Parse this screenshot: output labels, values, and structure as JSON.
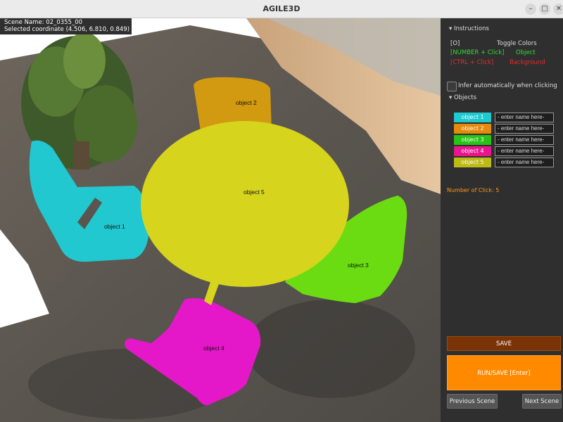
{
  "window": {
    "title": "AGILE3D",
    "minimize": "–",
    "maximize": "□",
    "close": "✕"
  },
  "overlay": {
    "scene_name": "Scene Name: 02_0355_00",
    "selected_coordinate": "Selected coordinate (4.506, 6.810, 0.849)"
  },
  "scene_objects": [
    {
      "label": "object 1",
      "color": "#22c8cf"
    },
    {
      "label": "object 2",
      "color": "#d29a10"
    },
    {
      "label": "object 3",
      "color": "#6bdc12"
    },
    {
      "label": "object 4",
      "color": "#e418c8"
    },
    {
      "label": "object 5",
      "color": "#d6d41c"
    }
  ],
  "panel": {
    "instructions_header": "▾ Instructions",
    "instructions": [
      {
        "key": "[O]",
        "action": "Toggle Colors",
        "color": "#dddddd"
      },
      {
        "key": "[NUMBER + Click]",
        "action": "Object",
        "color": "#35d935"
      },
      {
        "key": "[CTRL + Click]",
        "action": "Background",
        "color": "#e03030"
      }
    ],
    "infer_checkbox_label": "Infer automatically when clicking",
    "infer_checked": false,
    "objects_header": "▾ Objects",
    "objects": [
      {
        "label": "object 1",
        "color": "#1ecad0",
        "placeholder": "- enter name here-"
      },
      {
        "label": "object 2",
        "color": "#e48a0c",
        "placeholder": "- enter name here-"
      },
      {
        "label": "object 3",
        "color": "#27c316",
        "placeholder": "- enter name here-"
      },
      {
        "label": "object 4",
        "color": "#e8168e",
        "placeholder": "- enter name here-"
      },
      {
        "label": "object 5",
        "color": "#bcbb16",
        "placeholder": "- enter name here-"
      }
    ],
    "click_count": "Number of Click: 5",
    "save_label": "SAVE",
    "run_label": "RUN/SAVE [Enter]",
    "prev_label": "Previous Scene",
    "next_label": "Next Scene"
  }
}
